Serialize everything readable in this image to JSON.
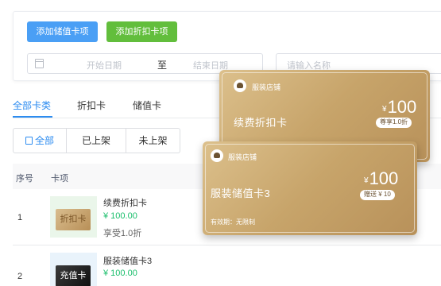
{
  "toolbar": {
    "add_stored_value_label": "添加储值卡项",
    "add_discount_label": "添加折扣卡项"
  },
  "filters": {
    "date_start_placeholder": "开始日期",
    "date_separator": "至",
    "date_end_placeholder": "结束日期",
    "name_placeholder": "请输入名称"
  },
  "tabs": [
    {
      "label": "全部卡类",
      "active": true
    },
    {
      "label": "折扣卡",
      "active": false
    },
    {
      "label": "储值卡",
      "active": false
    }
  ],
  "segments": [
    {
      "label": "全部",
      "active": true
    },
    {
      "label": "已上架",
      "active": false
    },
    {
      "label": "未上架",
      "active": false
    }
  ],
  "table": {
    "columns": [
      "序号",
      "卡项"
    ],
    "rows": [
      {
        "index": "1",
        "thumb_label": "折扣卡",
        "name": "续费折扣卡",
        "price": "¥ 100.00",
        "desc": "享受1.0折"
      },
      {
        "index": "2",
        "thumb_label": "充值卡",
        "name": "服装储值卡3",
        "price": "¥ 100.00",
        "desc": ""
      }
    ]
  },
  "cards": {
    "discount": {
      "store": "服装店铺",
      "title": "续费折扣卡",
      "currency": "¥",
      "amount": "100",
      "badge": "尊享1.0折"
    },
    "stored_value": {
      "store": "服装店铺",
      "title": "服装储值卡3",
      "currency": "¥",
      "amount": "100",
      "badge": "赠送 ¥ 10",
      "validity": "有效期：无限制"
    }
  },
  "colors": {
    "primary_blue": "#4a9ff5",
    "green_button": "#62be3c",
    "tab_active": "#2d8cf0",
    "price_green": "#19be6b",
    "card_gold": "#c7a46a"
  }
}
